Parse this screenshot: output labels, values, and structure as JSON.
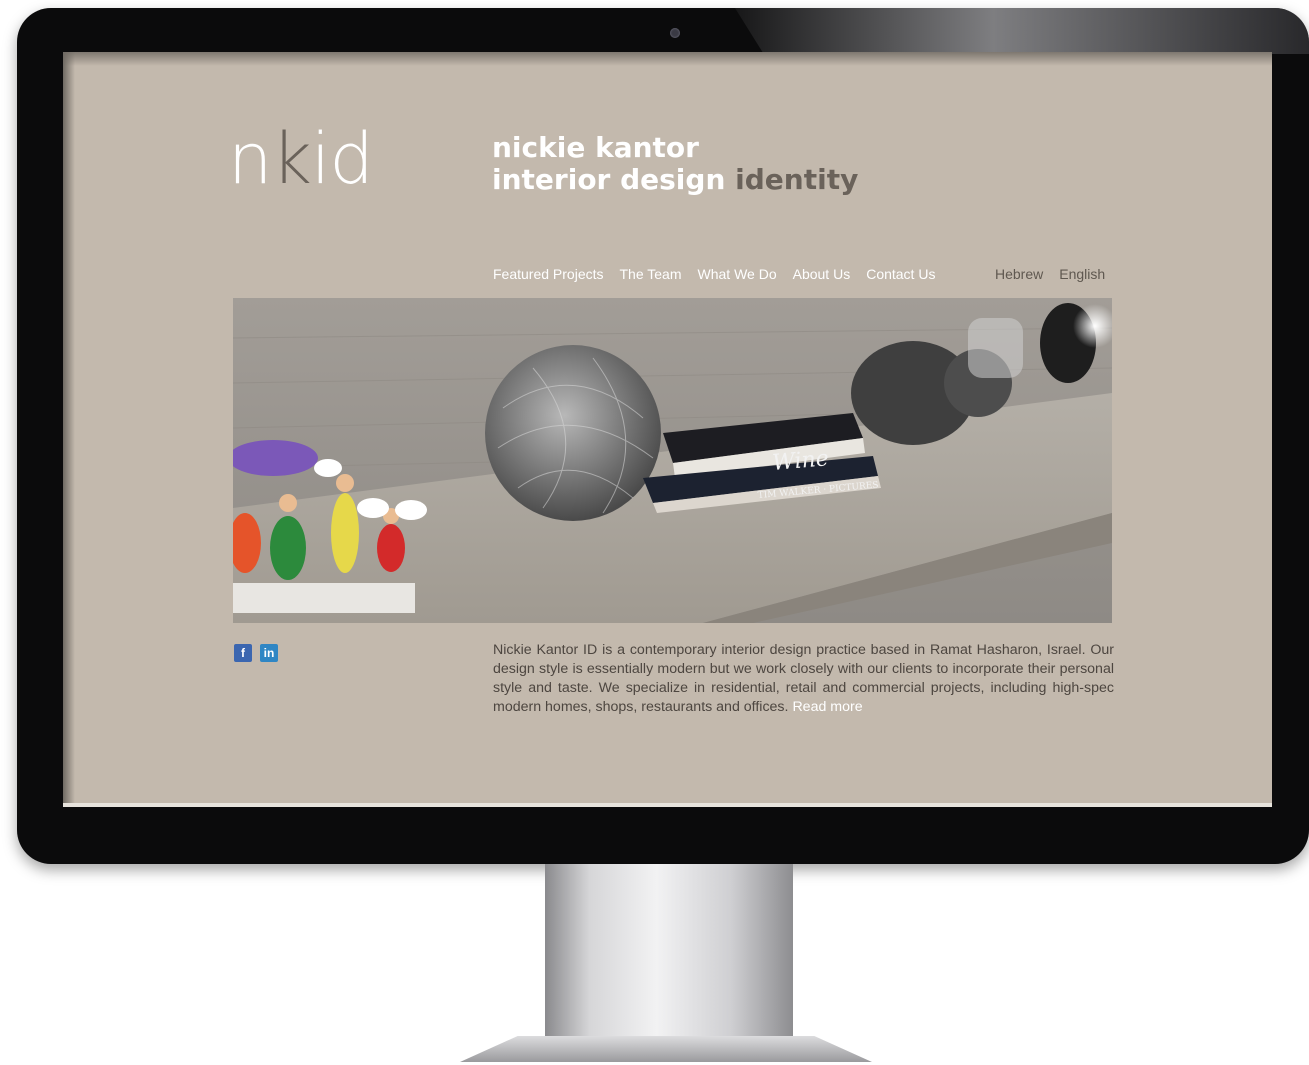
{
  "site": {
    "logo_prefix": "n",
    "logo_accent": "k",
    "logo_suffix": "id",
    "tagline_line1": "nickie kantor",
    "tagline_line2": "interior design",
    "tagline_line2_accent": "identity"
  },
  "nav": {
    "items": [
      {
        "label": "Featured Projects"
      },
      {
        "label": "The Team"
      },
      {
        "label": "What We Do"
      },
      {
        "label": "About Us"
      },
      {
        "label": "Contact Us"
      }
    ],
    "languages": [
      "Hebrew",
      "English"
    ]
  },
  "hero": {
    "book_top": "Wine",
    "book_bottom": "TIM WALKER · PICTURES"
  },
  "social": {
    "facebook": "f",
    "linkedin": "in"
  },
  "intro": {
    "text": "Nickie Kantor ID is a contemporary interior design practice based in Ramat Hasharon, Israel. Our design style is essentially modern but we work closely with our clients to incorporate their personal style and taste. We specialize in residential, retail and commercial projects, including high-spec modern homes, shops, restaurants and offices.",
    "read_more": "Read more"
  },
  "colors": {
    "page_bg": "#c3b9ad",
    "accent_text": "#6a625a",
    "monitor_bezel": "#0b0b0c"
  }
}
